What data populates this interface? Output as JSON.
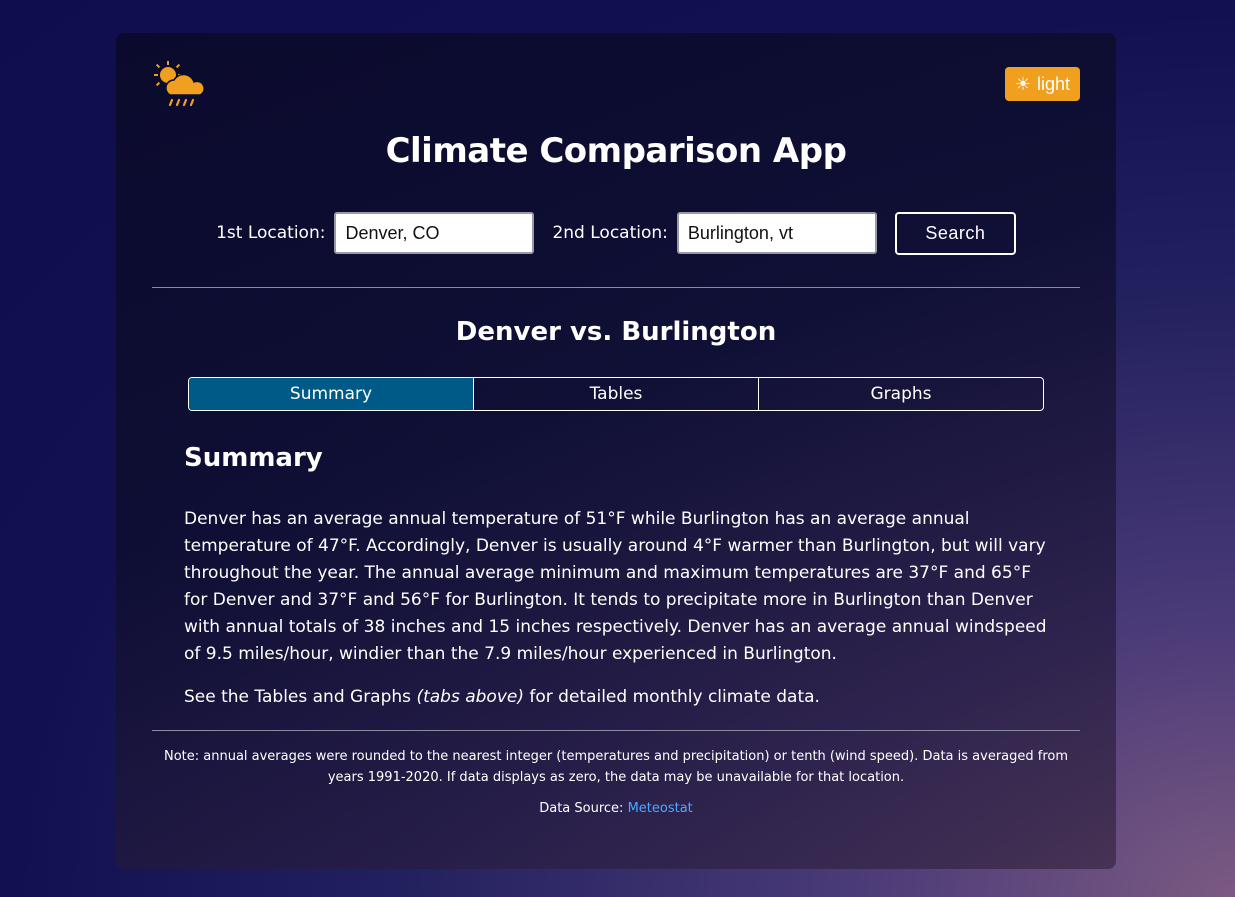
{
  "header": {
    "logo_icon": "sun-cloud-rain-icon",
    "theme_toggle": {
      "icon": "sun-icon",
      "label": "light"
    },
    "title": "Climate Comparison App"
  },
  "search": {
    "location1_label": "1st Location:",
    "location1_value": "Denver, CO",
    "location2_label": "2nd Location:",
    "location2_value": "Burlington, vt",
    "button_label": "Search"
  },
  "comparison": {
    "title": "Denver vs. Burlington",
    "tabs": [
      {
        "label": "Summary",
        "active": true
      },
      {
        "label": "Tables",
        "active": false
      },
      {
        "label": "Graphs",
        "active": false
      }
    ]
  },
  "summary": {
    "heading": "Summary",
    "paragraph": "Denver has an average annual temperature of 51°F while Burlington has an average annual temperature of 47°F. Accordingly, Denver is usually around 4°F warmer than Burlington, but will vary throughout the year. The annual average minimum and maximum temperatures are 37°F and 65°F for Denver and 37°F and 56°F for Burlington. It tends to precipitate more in Burlington than Denver with annual totals of 38 inches and 15 inches respectively. Denver has an average annual windspeed of 9.5 miles/hour, windier than the 7.9 miles/hour experienced in Burlington.",
    "see_prefix": "See the Tables and Graphs ",
    "see_emphasis": "(tabs above)",
    "see_suffix": " for detailed monthly climate data."
  },
  "footer": {
    "note": "Note: annual averages were rounded to the nearest integer (temperatures and precipitation) or tenth (wind speed). Data is averaged from years 1991-2020. If data displays as zero, the data may be unavailable for that location.",
    "source_label": "Data Source: ",
    "source_link": "Meteostat"
  },
  "colors": {
    "accent_orange": "#f0a01e",
    "active_tab": "#005a87",
    "link": "#4ea8ff"
  }
}
